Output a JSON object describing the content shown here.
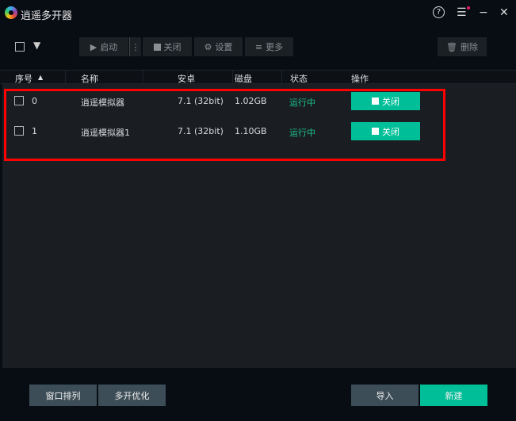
{
  "app": {
    "title": "逍遥多开器"
  },
  "window_controls": {
    "help": "?",
    "menu": "☰",
    "minimize": "−",
    "close": "✕"
  },
  "toolbar": {
    "start": "启动",
    "stop": "关闭",
    "settings": "设置",
    "more": "更多",
    "delete": "删除"
  },
  "table": {
    "columns": [
      "序号",
      "名称",
      "安卓",
      "磁盘",
      "状态",
      "操作"
    ],
    "rows": [
      {
        "index": "0",
        "name": "逍遥模拟器",
        "android": "7.1 (32bit)",
        "disk": "1.02GB",
        "status": "运行中",
        "action": "关闭"
      },
      {
        "index": "1",
        "name": "逍遥模拟器1",
        "android": "7.1 (32bit)",
        "disk": "1.10GB",
        "status": "运行中",
        "action": "关闭"
      }
    ]
  },
  "footer": {
    "arrange": "窗口排列",
    "optimize": "多开优化",
    "import": "导入",
    "new": "新建"
  },
  "colors": {
    "accent": "#00bf98",
    "status_running": "#1ec28b",
    "highlight": "#ff0000"
  }
}
